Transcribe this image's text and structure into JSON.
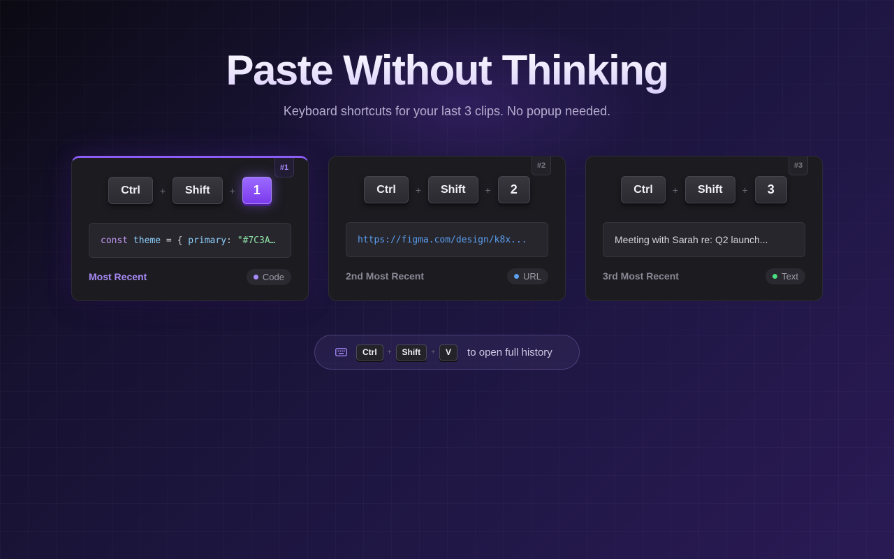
{
  "hero": {
    "title": "Paste Without Thinking",
    "subtitle": "Keyboard shortcuts for your last 3 clips. No popup needed."
  },
  "cards": [
    {
      "badge": "#1",
      "keys": [
        "Ctrl",
        "Shift",
        "1"
      ],
      "preview_tokens": [
        "const",
        " ",
        "theme",
        " = { ",
        "primary",
        ": ",
        "\"#7C3A…"
      ],
      "rank": "Most Recent",
      "type": "Code",
      "type_color": "#a78bfa",
      "active": true
    },
    {
      "badge": "#2",
      "keys": [
        "Ctrl",
        "Shift",
        "2"
      ],
      "preview": "https://figma.com/design/k8x...",
      "rank": "2nd Most Recent",
      "type": "URL",
      "type_color": "#5a9ff0",
      "active": false
    },
    {
      "badge": "#3",
      "keys": [
        "Ctrl",
        "Shift",
        "3"
      ],
      "preview": "Meeting with Sarah re: Q2 launch...",
      "rank": "3rd Most Recent",
      "type": "Text",
      "type_color": "#4ade80",
      "active": false
    }
  ],
  "plus_sign": "+",
  "history_hint": {
    "icon": "keyboard-icon",
    "keys": [
      "Ctrl",
      "Shift",
      "V"
    ],
    "text": "to open full history"
  },
  "colors": {
    "accent": "#8b5cf6",
    "background": "#171231"
  }
}
